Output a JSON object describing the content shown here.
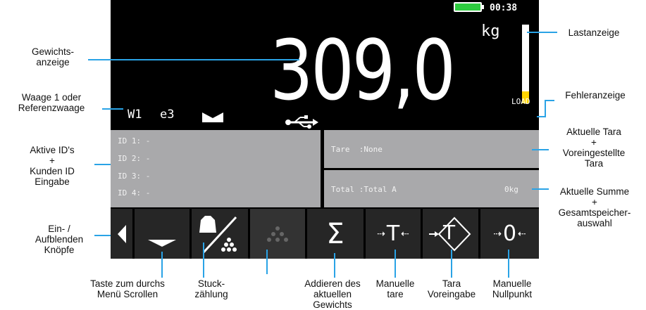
{
  "display": {
    "clock": "00:38",
    "unit": "kg",
    "weight": "309,0",
    "load_label": "LOAD",
    "scale_id": "W1",
    "class_label": "e3",
    "battery_color": "#2ecc40",
    "bar_color": "#ffd500",
    "bar_level": 0.15
  },
  "ids_panel": {
    "lines": [
      "ID 1: -",
      "ID 2: -",
      "ID 3: -",
      "ID 4: -"
    ]
  },
  "tare_panel": {
    "text": "Tare  :None"
  },
  "total_panel": {
    "text": "Total :Total A",
    "value": "0kg"
  },
  "buttons": {
    "manual_tare": "T",
    "preset_tare": "T",
    "manual_zero": "0",
    "sum": "Σ"
  },
  "annotations": {
    "lastanzeige": "Lastanzeige",
    "gewichtsanzeige": "Gewichts-\nanzeige",
    "waage": "Waage 1 oder\nReferenzwaage",
    "fehleranzeige": "Fehleranzeige",
    "aktive_ids": "Aktive ID's\n+\nKunden ID\nEingabe",
    "aktuelle_tara": "Aktuelle Tara\n+\nVoreingestellte\nTara",
    "aktuelle_summe": "Aktuelle Summe\n+\nGesamtspeicher-\nauswahl",
    "ein_aus": "Ein- /\nAufblenden\nKnöpfe",
    "scroll": "Taste zum durchs\nMenü Scrollen",
    "stueck": "Stuck-\nzählung",
    "addieren": "Addieren des\naktuellen\nGewichts",
    "manuelle_tare": "Manuelle\ntare",
    "tara_voreingabe": "Tara\nVoreingabe",
    "manuelle_nullpunkt": "Manuelle\nNullpunkt"
  }
}
